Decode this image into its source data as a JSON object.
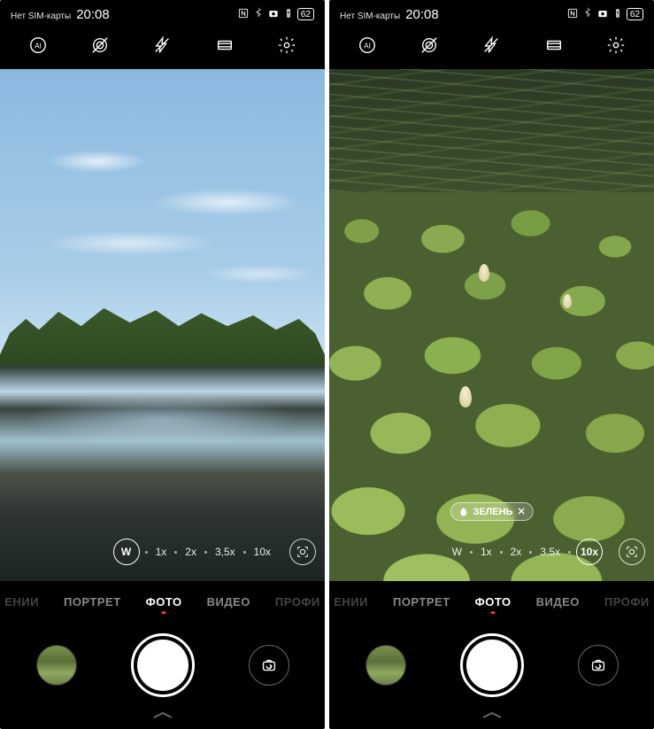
{
  "screens": [
    {
      "status": {
        "sim": "Нет SIM-карты",
        "time": "20:08",
        "battery": "62"
      },
      "zoom": {
        "active": "W",
        "levels": [
          "W",
          "1x",
          "2x",
          "3,5x",
          "10x"
        ]
      },
      "ai_tag": null,
      "modes": {
        "items": [
          "ЕНИИ",
          "ПОРТРЕТ",
          "ФОТО",
          "ВИДЕО",
          "ПРОФИ"
        ],
        "active_index": 2
      }
    },
    {
      "status": {
        "sim": "Нет SIM-карты",
        "time": "20:08",
        "battery": "62"
      },
      "zoom": {
        "active": "10x",
        "levels": [
          "W",
          "1x",
          "2x",
          "3,5x",
          "10x"
        ]
      },
      "ai_tag": {
        "label": "ЗЕЛЕНЬ"
      },
      "modes": {
        "items": [
          "ЕНИИ",
          "ПОРТРЕТ",
          "ФОТО",
          "ВИДЕО",
          "ПРОФИ"
        ],
        "active_index": 2
      }
    }
  ]
}
